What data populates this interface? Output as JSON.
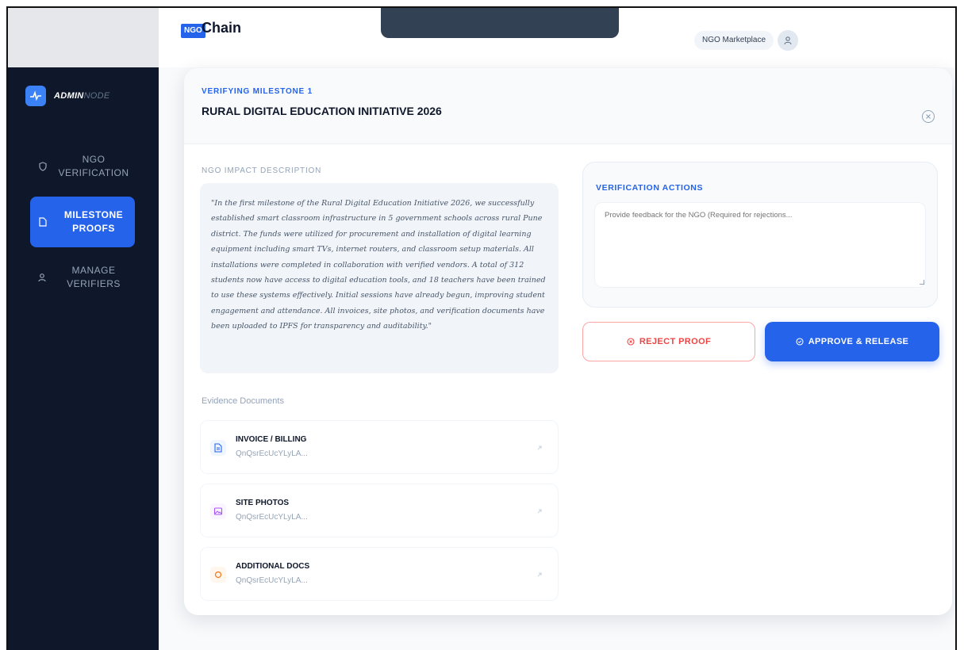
{
  "header": {
    "logo_badge": "NGO",
    "logo_text": "Chain",
    "marketplace_label": "NGO Marketplace"
  },
  "sidebar": {
    "brand_main": "ADMIN",
    "brand_sub": "NODE",
    "items": [
      {
        "label_line1": "NGO",
        "label_line2": "VERIFICATION",
        "icon": "shield-icon",
        "active": false
      },
      {
        "label_line1": "MILESTONE",
        "label_line2": "PROOFS",
        "icon": "file-icon",
        "active": true
      },
      {
        "label_line1": "MANAGE",
        "label_line2": "VERIFIERS",
        "icon": "users-icon",
        "active": false
      }
    ]
  },
  "modal": {
    "eyebrow": "VERIFYING MILESTONE 1",
    "title": "RURAL DIGITAL EDUCATION INITIATIVE 2026",
    "description_label": "NGO IMPACT DESCRIPTION",
    "description": "\"In the first milestone of the Rural Digital Education Initiative 2026, we successfully established smart classroom infrastructure in 5 government schools across rural Pune district. The funds were utilized for procurement and installation of digital learning equipment including smart TVs, internet routers, and classroom setup materials. All installations were completed in collaboration with verified vendors. A total of 312 students now have access to digital education tools, and 18 teachers have been trained to use these systems effectively. Initial sessions have already begun, improving student engagement and attendance. All invoices, site photos, and verification documents have been uploaded to IPFS for transparency and auditability.\"",
    "evidence_label": "Evidence Documents",
    "documents": [
      {
        "name": "INVOICE / BILLING",
        "hash": "QnQsrEcUcYLyLA..."
      },
      {
        "name": "SITE PHOTOS",
        "hash": "QnQsrEcUcYLyLA..."
      },
      {
        "name": "ADDITIONAL DOCS",
        "hash": "QnQsrEcUcYLyLA..."
      }
    ],
    "actions": {
      "title": "VERIFICATION ACTIONS",
      "feedback_placeholder": "Provide feedback for the NGO (Required for rejections...",
      "reject_label": "REJECT PROOF",
      "approve_label": "APPROVE & RELEASE"
    }
  },
  "colors": {
    "accent": "#2563eb",
    "sidebar_bg": "#0f172a",
    "reject": "#ef4444"
  }
}
